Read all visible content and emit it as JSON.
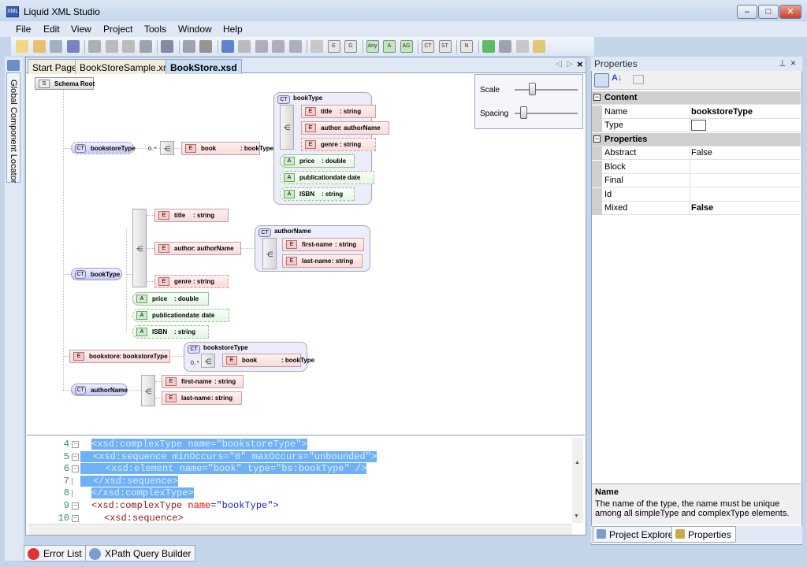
{
  "window": {
    "title": "Liquid XML Studio",
    "icon": "xml-app-icon",
    "controls": [
      "minimize",
      "maximize",
      "close"
    ]
  },
  "menu": [
    "File",
    "Edit",
    "View",
    "Project",
    "Tools",
    "Window",
    "Help"
  ],
  "toolbar_icons": [
    "new",
    "open",
    "save",
    "save-all",
    "cut",
    "copy",
    "paste",
    "undo",
    "print",
    "print-preview",
    "goto",
    "back",
    "forward",
    "sequence",
    "choice",
    "all",
    "any",
    "E",
    "G",
    "Any",
    "A",
    "AG",
    "CT",
    "ST",
    "N",
    "validate",
    "xml-generate",
    "find",
    "wizard"
  ],
  "left_panel": {
    "tab_label": "Global Component Locator"
  },
  "document_tabs": [
    {
      "label": "Start Page",
      "active": false
    },
    {
      "label": "BookStoreSample.xml",
      "active": false
    },
    {
      "label": "BookStore.xsd",
      "active": true
    }
  ],
  "scale_panel": {
    "scale_label": "Scale",
    "spacing_label": "Spacing",
    "scale_value": 0.25,
    "spacing_value": 0.1
  },
  "diagram": {
    "root": {
      "badge": "S",
      "name": "Schema Root"
    },
    "groups": [
      {
        "badge": "CT",
        "name": "bookType"
      },
      {
        "badge": "CT",
        "name": "authorName"
      },
      {
        "badge": "CT",
        "name": "bookstoreType"
      }
    ],
    "occurs": "0..*",
    "nodes": [
      {
        "badge": "CT",
        "name": "bookstoreType",
        "type": ""
      },
      {
        "badge": "E",
        "name": "book",
        "type": ": bookType"
      },
      {
        "badge": "E",
        "name": "title",
        "type": ": string"
      },
      {
        "badge": "E",
        "name": "author",
        "type": ": authorName"
      },
      {
        "badge": "E",
        "name": "genre",
        "type": ": string"
      },
      {
        "badge": "A",
        "name": "price",
        "type": ": double"
      },
      {
        "badge": "A",
        "name": "publicationdate",
        "type": ": date"
      },
      {
        "badge": "A",
        "name": "ISBN",
        "type": ": string"
      },
      {
        "badge": "CT",
        "name": "bookType",
        "type": ""
      },
      {
        "badge": "E",
        "name": "title",
        "type": ": string"
      },
      {
        "badge": "E",
        "name": "author",
        "type": ": authorName"
      },
      {
        "badge": "E",
        "name": "genre",
        "type": ": string"
      },
      {
        "badge": "A",
        "name": "price",
        "type": ": double"
      },
      {
        "badge": "A",
        "name": "publicationdate",
        "type": ": date"
      },
      {
        "badge": "A",
        "name": "ISBN",
        "type": ": string"
      },
      {
        "badge": "E",
        "name": "first-name",
        "type": ": string"
      },
      {
        "badge": "E",
        "name": "last-name",
        "type": ": string"
      },
      {
        "badge": "E",
        "name": "bookstore",
        "type": ": bookstoreType"
      },
      {
        "badge": "E",
        "name": "book",
        "type": ": bookType"
      },
      {
        "badge": "CT",
        "name": "authorName",
        "type": ""
      },
      {
        "badge": "E",
        "name": "first-name",
        "type": ": string"
      },
      {
        "badge": "E",
        "name": "last-name",
        "type": ": string"
      }
    ]
  },
  "code": {
    "lines": [
      {
        "n": "4",
        "parts": [
          [
            "k",
            "<xsd:complexType "
          ],
          [
            "a",
            "name"
          ],
          [
            "p",
            "=\"bookstoreType\">"
          ]
        ],
        "indent": 0,
        "selected": true
      },
      {
        "n": "5",
        "parts": [
          [
            "k",
            "<xsd:sequence "
          ],
          [
            "a",
            "minOccurs"
          ],
          [
            "p",
            "=\"0\" "
          ],
          [
            "a",
            "maxOccurs"
          ],
          [
            "p",
            "=\"unbounded\">"
          ]
        ],
        "indent": 1,
        "selected": true
      },
      {
        "n": "6",
        "parts": [
          [
            "k",
            "<xsd:element "
          ],
          [
            "a",
            "name"
          ],
          [
            "p",
            "=\"book\" "
          ],
          [
            "a",
            "type"
          ],
          [
            "p",
            "=\"bs:bookType\" />"
          ]
        ],
        "indent": 2,
        "selected": true
      },
      {
        "n": "7",
        "parts": [
          [
            "k",
            "</xsd:sequence>"
          ]
        ],
        "indent": 1,
        "selected": true
      },
      {
        "n": "8",
        "parts": [
          [
            "k",
            "</xsd:complexType>"
          ]
        ],
        "indent": 0,
        "selected": true
      },
      {
        "n": "9",
        "parts": [
          [
            "k",
            "<xsd:complexType "
          ],
          [
            "a",
            "name"
          ],
          [
            "p",
            "=\"bookType\">"
          ]
        ],
        "indent": 0,
        "selected": false
      },
      {
        "n": "10",
        "parts": [
          [
            "k",
            "<xsd:sequence>"
          ]
        ],
        "indent": 1,
        "selected": false
      }
    ]
  },
  "bottom_tabs": [
    {
      "label": "Error List",
      "icon": "error-list-icon"
    },
    {
      "label": "XPath Query Builder",
      "icon": "xpath-icon"
    }
  ],
  "properties": {
    "title": "Properties",
    "categories": [
      {
        "label": "Content",
        "rows": [
          {
            "key": "Name",
            "value": "bookstoreType",
            "bold": true
          },
          {
            "key": "Type",
            "value": ""
          }
        ]
      },
      {
        "label": "Properties",
        "rows": [
          {
            "key": "Abstract",
            "value": "False"
          },
          {
            "key": "Block",
            "value": ""
          },
          {
            "key": "Final",
            "value": ""
          },
          {
            "key": "Id",
            "value": ""
          },
          {
            "key": "Mixed",
            "value": "False",
            "bold": true
          }
        ]
      }
    ],
    "description": {
      "title": "Name",
      "text": "The name of the type, the name must be unique among all simpleType and complexType elements."
    },
    "tabs": [
      {
        "label": "Project Explorer",
        "active": false
      },
      {
        "label": "Properties",
        "active": true
      }
    ]
  }
}
